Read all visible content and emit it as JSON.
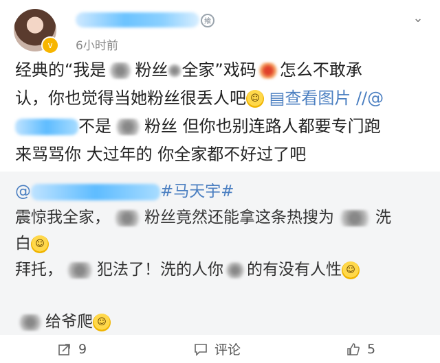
{
  "header": {
    "time": "6小时前",
    "level_badge": "飨",
    "avatar_badge": "v"
  },
  "post": {
    "line1a": "经典的“我是",
    "line1b": "粉丝",
    "line1c": "全家”戏码",
    "line1d": "怎么不敢承",
    "line2a": "认，你也觉得当她粉丝很丢人吧",
    "view_image": "查看图片",
    "mention_prefix": "//@",
    "line3a": "不是",
    "line3b": "粉丝 但你也别连路人都要专门跑",
    "line4": "来骂骂你 大过年的 你全家都不好过了吧"
  },
  "repost": {
    "at": "@",
    "hashtag": "#马天宇#",
    "line2a": "震惊我全家，",
    "line2b": "粉丝竟然还能拿这条热搜为",
    "line2c": "洗",
    "line3": "白",
    "line4a": "拜托，",
    "line4b": "犯法了！洗的人你",
    "line4c": "的有没有人性",
    "line6": "给爷爬"
  },
  "footer": {
    "repost_count": "9",
    "comment_label": "评论",
    "like_count": "5"
  }
}
